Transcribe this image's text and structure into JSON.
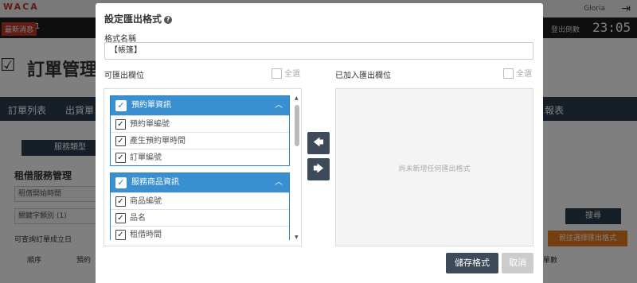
{
  "background": {
    "logo": "WACA",
    "user_name": "Gloria",
    "latest_label": "最新消息",
    "latest_count": "1",
    "logout_label": "登出倒數",
    "countdown": "23:05",
    "page_title": "訂單管理",
    "tabs": [
      "訂單列表",
      "出貨單",
      "報表"
    ],
    "subtab": "服務類型",
    "section_title": "租借服務管理",
    "field1": "租借開始時間",
    "field2": "關鍵字類別 (1)",
    "search_button": "搜尋",
    "notice": "可查詢訂單成立日",
    "orange_button": "前往選擇匯出格式",
    "columns": [
      "順序",
      "預約",
      "單數"
    ]
  },
  "modal": {
    "title": "設定匯出格式",
    "help_icon": "question-circle-icon",
    "name_label": "格式名稱",
    "name_value": "【帳篷】",
    "available_label": "可匯出欄位",
    "added_label": "已加入匯出欄位",
    "select_all": "全選",
    "groups": [
      {
        "title": "預約單資訊",
        "items": [
          "預約單編號",
          "產生預約單時間",
          "訂單編號"
        ]
      },
      {
        "title": "服務商品資訊",
        "items": [
          "商品編號",
          "品名",
          "租借時間"
        ]
      }
    ],
    "move_left_icon": "arrow-left-icon",
    "move_right_icon": "arrow-right-icon",
    "empty_text": "尚未新增任何匯出格式",
    "save_label": "儲存格式",
    "cancel_label": "取消"
  },
  "colors": {
    "group_header": "#3a8fd0",
    "dark_button": "#3d4a5a",
    "disabled_button": "#cccccc",
    "orange": "#e67e22"
  }
}
